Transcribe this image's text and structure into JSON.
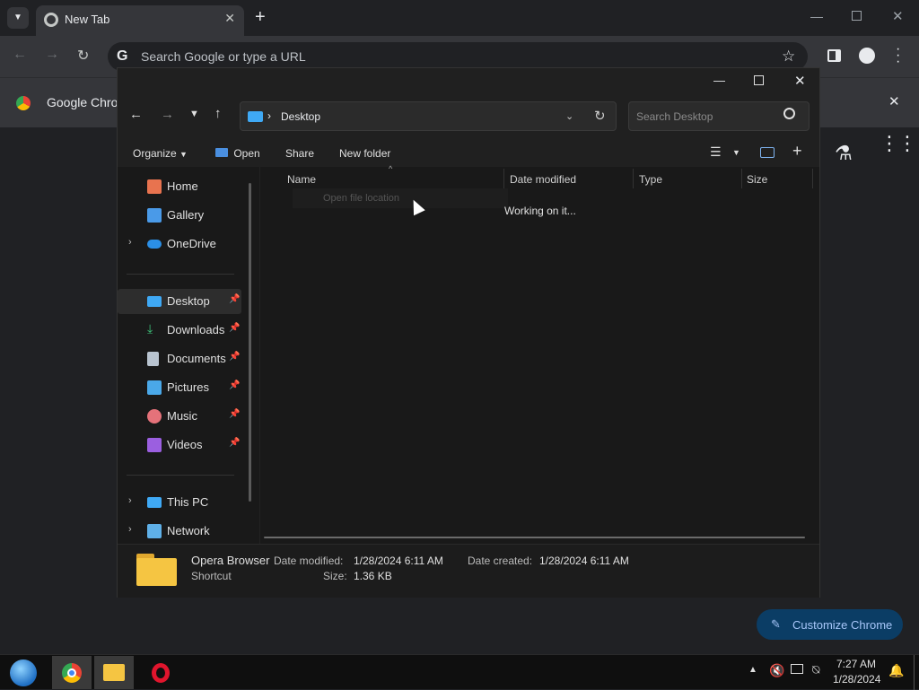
{
  "browser": {
    "tab_title": "New Tab",
    "omnibox_placeholder": "Search Google or type a URL",
    "bookmark_label": "Google Chrom",
    "customize_label": "Customize Chrome"
  },
  "explorer": {
    "address_location": "Desktop",
    "search_placeholder": "Search Desktop",
    "commands": {
      "organize": "Organize",
      "open": "Open",
      "share": "Share",
      "new_folder": "New folder"
    },
    "columns": {
      "name": "Name",
      "date_modified": "Date modified",
      "type": "Type",
      "size": "Size"
    },
    "status": "Working on it...",
    "ghost_menu": "Open file location",
    "sidebar": {
      "home": "Home",
      "gallery": "Gallery",
      "onedrive": "OneDrive",
      "desktop": "Desktop",
      "downloads": "Downloads",
      "documents": "Documents",
      "pictures": "Pictures",
      "music": "Music",
      "videos": "Videos",
      "this_pc": "This PC",
      "network": "Network"
    },
    "details": {
      "name": "Opera Browser",
      "kind": "Shortcut",
      "date_modified_label": "Date modified:",
      "date_modified_value": "1/28/2024 6:11 AM",
      "date_created_label": "Date created:",
      "date_created_value": "1/28/2024 6:11 AM",
      "size_label": "Size:",
      "size_value": "1.36 KB"
    }
  },
  "taskbar": {
    "time": "7:27 AM",
    "date": "1/28/2024"
  },
  "colors": {
    "accent_blue": "#a8c7fa",
    "customize_bg": "#0b3d65",
    "folder_yellow": "#f5c542"
  }
}
